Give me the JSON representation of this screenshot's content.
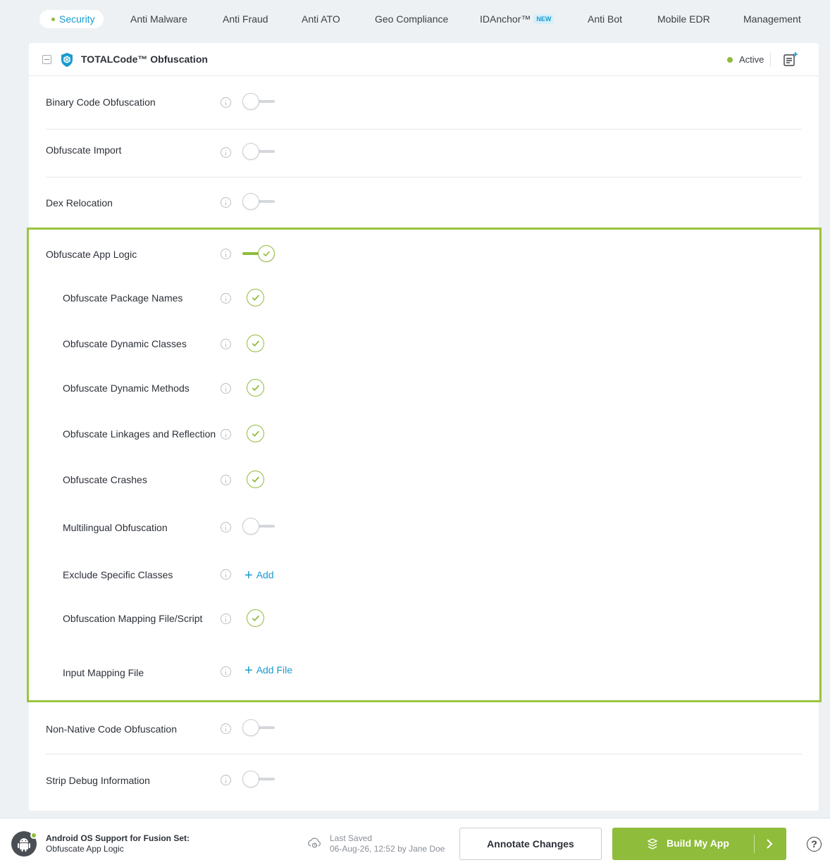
{
  "nav": {
    "tabs": [
      {
        "label": "Security",
        "active": true
      },
      {
        "label": "Anti Malware"
      },
      {
        "label": "Anti Fraud"
      },
      {
        "label": "Anti ATO"
      },
      {
        "label": "Geo Compliance"
      },
      {
        "label": "IDAnchor™",
        "badge": "NEW"
      },
      {
        "label": "Anti Bot"
      },
      {
        "label": "Mobile EDR"
      },
      {
        "label": "Management"
      }
    ]
  },
  "card": {
    "title": "TOTALCode™ Obfuscation",
    "status": "Active",
    "accent_color": "#8fbc3a",
    "link_color": "#1a9ad0"
  },
  "settings": [
    {
      "label": "Binary Code Obfuscation",
      "control": "toggle",
      "enabled": false
    },
    {
      "label": "Obfuscate Import",
      "control": "toggle",
      "enabled": false
    },
    {
      "label": "Dex Relocation",
      "control": "toggle",
      "enabled": false
    },
    {
      "label": "Obfuscate App Logic",
      "control": "toggle",
      "enabled": true,
      "children": [
        {
          "label": "Obfuscate Package Names",
          "control": "check",
          "checked": true
        },
        {
          "label": "Obfuscate Dynamic Classes",
          "control": "check",
          "checked": true
        },
        {
          "label": "Obfuscate Dynamic Methods",
          "control": "check",
          "checked": true
        },
        {
          "label": "Obfuscate Linkages and Reflection",
          "control": "check",
          "checked": true
        },
        {
          "label": "Obfuscate Crashes",
          "control": "check",
          "checked": true
        },
        {
          "label": "Multilingual Obfuscation",
          "control": "toggle",
          "enabled": false
        },
        {
          "label": "Exclude Specific Classes",
          "control": "link",
          "action_label": "Add"
        },
        {
          "label": "Obfuscation Mapping File/Script",
          "control": "check",
          "checked": true
        },
        {
          "label": "Input Mapping File",
          "control": "link",
          "action_label": "Add File"
        }
      ]
    },
    {
      "label": "Non-Native Code Obfuscation",
      "control": "toggle",
      "enabled": false
    },
    {
      "label": "Strip Debug Information",
      "control": "toggle",
      "enabled": false
    }
  ],
  "footer": {
    "os_title": "Android OS Support for Fusion Set:",
    "os_subtitle": "Obfuscate App Logic",
    "last_saved_label": "Last Saved",
    "last_saved_value": "06-Aug-26, 12:52 by Jane Doe",
    "annotate_label": "Annotate Changes",
    "build_label": "Build My App",
    "help_label": "?"
  }
}
